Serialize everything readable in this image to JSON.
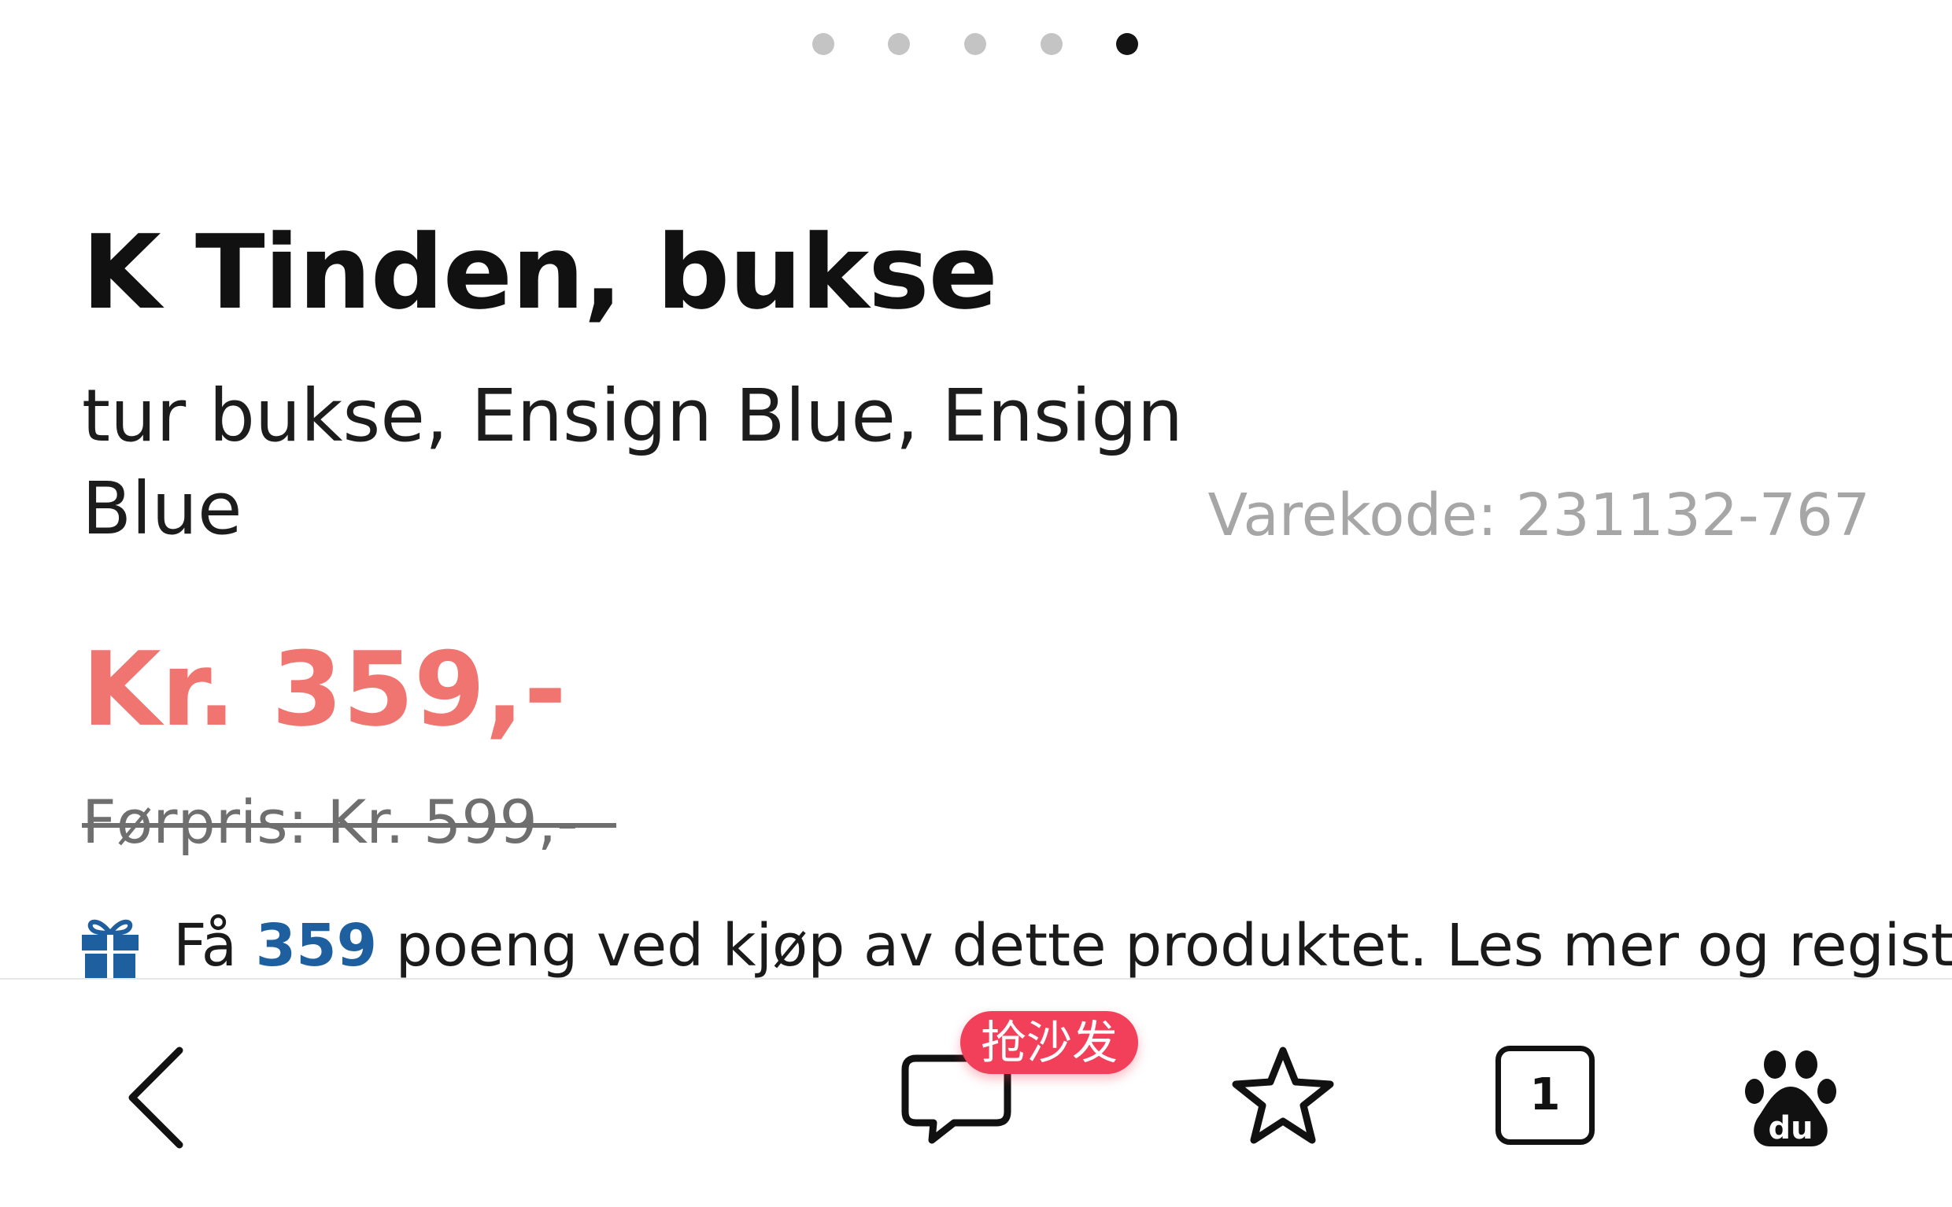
{
  "carousel": {
    "total": 5,
    "active_index": 4
  },
  "product": {
    "title": "K Tinden, bukse",
    "subtitle": "tur bukse, Ensign Blue, Ensign Blue",
    "sku_label": "Varekode:",
    "sku_value": "231132-767",
    "price": "Kr. 359,-",
    "old_price": "Førpris: Kr. 599,-"
  },
  "points": {
    "prefix": "Få",
    "value": "359",
    "suffix": "poeng ved kjøp av dette produktet. Les mer og registrer"
  },
  "bottombar": {
    "comment_badge": "抢沙发",
    "tabs_count": "1"
  },
  "colors": {
    "price": "#f07470",
    "points_accent": "#1e5fa0",
    "badge": "#f2405a",
    "sku": "#a6a6a6"
  },
  "icons": [
    "back-arrow-icon",
    "comment-icon",
    "star-icon",
    "tabs-icon",
    "baidu-paw-icon",
    "gift-icon"
  ]
}
